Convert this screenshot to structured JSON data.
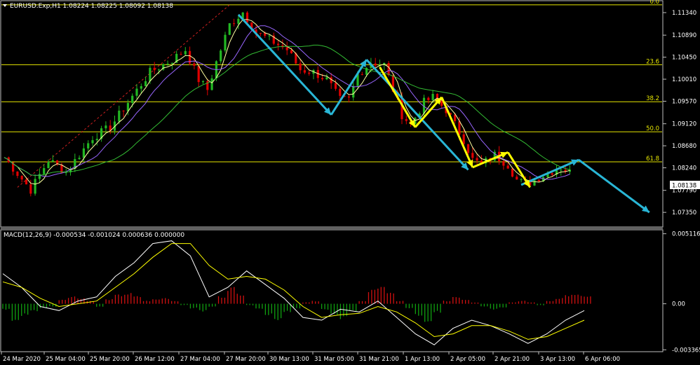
{
  "header": {
    "menu_icon": "triangle-down-icon",
    "symbol_info": "EURUSD.Exp,H1  1.08224 1.08225 1.08092 1.08138",
    "macd_info": "MACD(12,26,9) -0.000534 -0.001024 0.000636 0.000000"
  },
  "price_badge": "1.08138",
  "colors": {
    "background": "#000000",
    "bull_candle": "#22b822",
    "bear_candle": "#e00000",
    "fib_lines": "#e6e600",
    "trend_arrows": "#29b6d6",
    "wave_arrows": "#ffff00",
    "ma_fast": "#ffffa0",
    "ma_mid": "#9966ff",
    "ma_slow": "#33bb33",
    "macd_line": "#ffffff",
    "signal_line": "#ffff00"
  },
  "chart_data": [
    {
      "type": "candlestick",
      "symbol": "EURUSD.Exp",
      "timeframe": "H1",
      "ohlc_last": {
        "open": 1.08224,
        "high": 1.08225,
        "low": 1.08092,
        "close": 1.08138
      },
      "ylim": [
        1.071,
        1.1155
      ],
      "y_ticks": [
        "1.11340",
        "1.10890",
        "1.10450",
        "1.10010",
        "1.09570",
        "1.09120",
        "1.08680",
        "1.08240",
        "1.07790",
        "1.07350"
      ],
      "x_ticks": [
        "24 Mar 2020",
        "25 Mar 04:00",
        "25 Mar 20:00",
        "26 Mar 12:00",
        "27 Mar 04:00",
        "27 Mar 20:00",
        "30 Mar 13:00",
        "31 Mar 05:00",
        "31 Mar 21:00",
        "1 Apr 13:00",
        "2 Apr 05:00",
        "2 Apr 21:00",
        "3 Apr 13:00",
        "6 Apr 06:00"
      ],
      "path": [
        [
          0,
          1.0845
        ],
        [
          6,
          1.078
        ],
        [
          10,
          1.084
        ],
        [
          14,
          1.0815
        ],
        [
          20,
          1.0885
        ],
        [
          24,
          1.0905
        ],
        [
          28,
          1.0955
        ],
        [
          33,
          1.1015
        ],
        [
          38,
          1.104
        ],
        [
          41,
          1.106
        ],
        [
          44,
          1.1
        ],
        [
          46,
          1.098
        ],
        [
          48,
          1.1035
        ],
        [
          51,
          1.111
        ],
        [
          54,
          1.1135
        ],
        [
          57,
          1.1095
        ],
        [
          60,
          1.108
        ],
        [
          64,
          1.106
        ],
        [
          67,
          1.102
        ],
        [
          70,
          1.1015
        ],
        [
          73,
          1.1
        ],
        [
          76,
          1.096
        ],
        [
          78,
          1.096
        ],
        [
          80,
          1.101
        ],
        [
          83,
          1.1035
        ],
        [
          86,
          1.103
        ],
        [
          88,
          1.098
        ],
        [
          90,
          1.093
        ],
        [
          92,
          1.091
        ],
        [
          95,
          1.0955
        ],
        [
          97,
          1.0965
        ],
        [
          100,
          1.094
        ],
        [
          102,
          1.091
        ],
        [
          104,
          1.088
        ],
        [
          106,
          1.084
        ],
        [
          108,
          1.083
        ],
        [
          111,
          1.085
        ],
        [
          114,
          1.083
        ],
        [
          116,
          1.08
        ],
        [
          118,
          1.079
        ],
        [
          121,
          1.0805
        ],
        [
          124,
          1.0818
        ],
        [
          126,
          1.0825
        ],
        [
          128,
          1.0815
        ]
      ],
      "moving_averages": [
        "ma_fast",
        "ma_mid",
        "ma_slow"
      ],
      "fibonacci_levels": [
        {
          "label": "0.0",
          "price": 1.11495
        },
        {
          "label": "23.6",
          "price": 1.103
        },
        {
          "label": "38.2",
          "price": 1.0956
        },
        {
          "label": "50.0",
          "price": 1.0896
        },
        {
          "label": "61.8",
          "price": 1.0836
        }
      ],
      "trend_arrows": [
        {
          "from": [
            53,
            1.113
          ],
          "to": [
            74,
            1.093
          ]
        },
        {
          "from": [
            74,
            1.093
          ],
          "to": [
            82,
            1.104
          ]
        },
        {
          "from": [
            82,
            1.104
          ],
          "to": [
            105,
            1.082
          ]
        },
        {
          "from": [
            117,
            1.079
          ],
          "to": [
            130,
            1.084
          ]
        },
        {
          "from": [
            130,
            1.084
          ],
          "to": [
            146,
            1.0735
          ]
        }
      ],
      "wave_arrows": [
        [
          [
            85,
            1.1025
          ],
          [
            93,
            1.0905
          ],
          [
            99,
            1.0965
          ],
          [
            106,
            1.0825
          ],
          [
            114,
            1.0855
          ],
          [
            119,
            1.0785
          ]
        ]
      ]
    },
    {
      "type": "macd",
      "name": "MACD(12,26,9)",
      "values": {
        "macd": -0.000534,
        "signal": -0.001024,
        "histogram": 0.000636
      },
      "ylim": [
        -0.0034,
        0.0052
      ],
      "y_ticks": [
        "0.005116",
        "0.00",
        "-0.003365"
      ],
      "histogram": [
        -0.0004,
        -0.0012,
        -0.0008,
        -0.0005,
        -0.0003,
        -0.0002,
        0.0003,
        0.0005,
        0.0004,
        0.0002,
        -0.0002,
        0.0003,
        0.0006,
        0.0007,
        0.0005,
        0.0002,
        0.0003,
        0.0004,
        0.0002,
        -0.0001,
        -0.0003,
        -0.0005,
        -0.0002,
        0.0005,
        0.0011,
        0.0007,
        -0.0001,
        -0.0004,
        -0.0008,
        -0.0012,
        -0.0006,
        -0.0003,
        0.0001,
        0.0002,
        -0.0004,
        -0.0007,
        -0.001,
        -0.0005,
        0.0002,
        0.0009,
        0.0013,
        0.0007,
        0.0002,
        -0.0003,
        -0.0008,
        -0.0012,
        -0.0006,
        0.0002,
        0.0005,
        0.0003,
        0.0001,
        -0.0002,
        -0.0004,
        -0.0003,
        0.0001,
        0.0002,
        0.0001,
        -0.0001,
        0.0002,
        0.0004,
        0.0006,
        0.0006,
        0.0005
      ],
      "macd": [
        0.0022,
        0.0012,
        -0.0002,
        -0.0005,
        0.0002,
        0.0005,
        0.002,
        0.003,
        0.0044,
        0.0046,
        0.0035,
        0.0005,
        0.0012,
        0.0024,
        0.0014,
        0.0004,
        -0.001,
        -0.0012,
        -0.0004,
        -0.0006,
        0.0002,
        -0.001,
        -0.0022,
        -0.003,
        -0.0018,
        -0.0012,
        -0.0016,
        -0.0022,
        -0.0029,
        -0.0022,
        -0.0012,
        -0.0005
      ],
      "signal": [
        0.0016,
        0.0012,
        0.0004,
        -0.0002,
        0.0,
        0.0002,
        0.0012,
        0.0022,
        0.0034,
        0.0044,
        0.0044,
        0.0028,
        0.0018,
        0.002,
        0.0018,
        0.001,
        -0.0002,
        -0.001,
        -0.0008,
        -0.0007,
        -0.0002,
        -0.0006,
        -0.0014,
        -0.0024,
        -0.0022,
        -0.0016,
        -0.0016,
        -0.002,
        -0.0026,
        -0.0024,
        -0.0018,
        -0.0012
      ]
    }
  ]
}
